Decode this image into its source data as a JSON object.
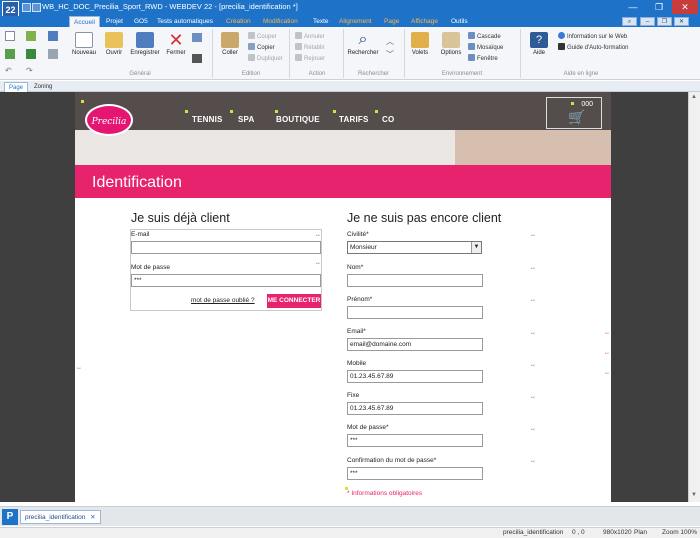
{
  "window": {
    "app_icon_label": "22",
    "title": "WB_HC_DOC_Precilia_Sport_RWD - WEBDEV 22 - [precilia_identification *]",
    "min": "—",
    "restore": "❐",
    "close": "✕"
  },
  "menus": [
    "Accueil",
    "Projet",
    "GO5",
    "Tests automatiques",
    "Création",
    "Modification",
    "Texte",
    "Alignement",
    "Page",
    "Affichage",
    "Outils"
  ],
  "ribbon": {
    "buttons": {
      "nouveau": "Nouveau",
      "ouvrir": "Ouvrir",
      "enregistrer": "Enregistrer",
      "fermer": "Fermer",
      "coller": "Coller",
      "rechercher": "Rechercher",
      "volets": "Volets",
      "options": "Options",
      "aide": "Aide"
    },
    "small": {
      "couper": "Couper",
      "copier": "Copier",
      "dupliquer": "Dupliquer",
      "annuler": "Annuler",
      "retablir": "Rétablir",
      "rejouer": "Rejouer",
      "cascade": "Cascade",
      "mosaique": "Mosaïque",
      "fenetre": "Fenêtre",
      "info_web": "Information sur le Web",
      "guide": "Guide d'Auto-formation"
    },
    "groups": {
      "general": "Général",
      "edition": "Edition",
      "action": "Action",
      "rechercher": "Rechercher",
      "environnement": "Environnement",
      "aide": "Aide en ligne"
    }
  },
  "view_tabs": [
    "Page",
    "Zoning"
  ],
  "site": {
    "logo_text": "Precilia",
    "nav": [
      "TENNIS",
      "SPA",
      "BOUTIQUE",
      "TARIFS",
      "CO"
    ],
    "cart_count": "000",
    "page_title": "Identification"
  },
  "login": {
    "title": "Je suis déjà client",
    "email_label": "E-mail",
    "email_value": "",
    "password_label": "Mot de passe",
    "password_value": "***",
    "forgot_link": "mot de passe oublié ?",
    "connect_button": "ME CONNECTER"
  },
  "register": {
    "title": "Je ne suis pas encore client",
    "civility_label": "Civilité*",
    "civility_value": "Monsieur",
    "lastname_label": "Nom*",
    "lastname_value": "",
    "firstname_label": "Prénom*",
    "firstname_value": "",
    "email_label": "Email*",
    "email_value": "email@domaine.com",
    "mobile_label": "Mobile",
    "mobile_value": "01.23.45.67.89",
    "phone_label": "Fixe",
    "phone_value": "01.23.45.67.89",
    "password_label": "Mot de passe*",
    "password_value": "***",
    "confirm_label": "Confirmation du mot de passe*",
    "confirm_value": "***",
    "required_note": "* Informations obligatoires"
  },
  "taskbar": {
    "icon_label": "P",
    "tab_label": "precilia_identification",
    "tab_close": "✕"
  },
  "status": {
    "page_name": "precilia_identification",
    "coords": "0 , 0",
    "size": "980x1020",
    "mode": "Plan",
    "zoom": "Zoom 100%"
  },
  "colors": {
    "accent": "#1e73c8",
    "brand_pink": "#e8236d"
  }
}
